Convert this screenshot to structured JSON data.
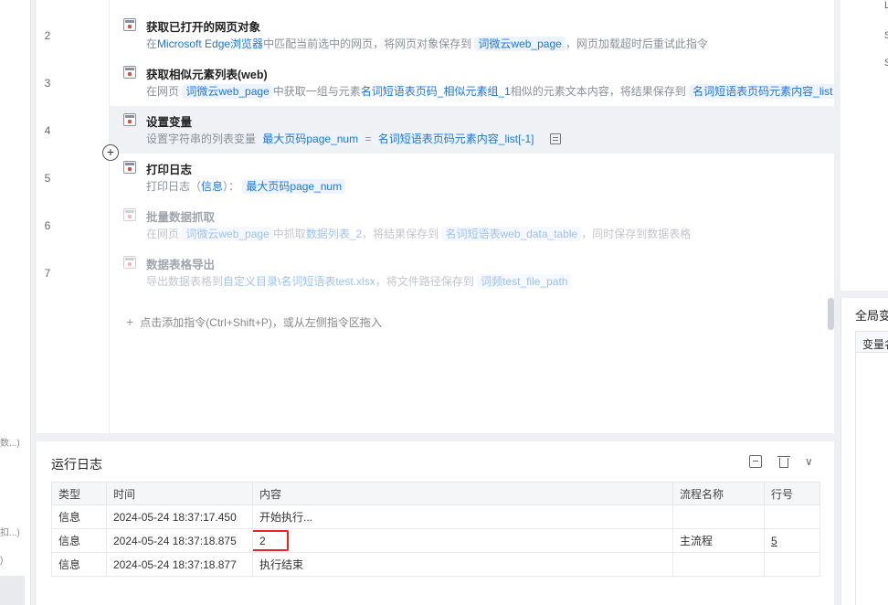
{
  "left_panel": {
    "fragments": [
      "数...)",
      "扣...)",
      ")"
    ]
  },
  "editor": {
    "line_numbers": [
      "2",
      "3",
      "4",
      "5",
      "6",
      "7"
    ],
    "steps": [
      {
        "title": "获取已打开的网页对象",
        "desc": {
          "t1": "在",
          "b1": "Microsoft Edge浏览器",
          "t2": "中匹配当前选中的网页，将网页对象保存到",
          "c1": "词微云web_page",
          "t3": "，网页加载超时后重试此指令"
        }
      },
      {
        "title": "获取相似元素列表(web)",
        "desc": {
          "t1": "在网页",
          "c1": "词微云web_page",
          "t2": "中获取一组与元素",
          "b1": "名词短语表页码_相似元素组_1",
          "t3": "相似的元素文本内容，将结果保存到",
          "c2": "名词短语表页码元素内容_list"
        }
      },
      {
        "title": "设置变量",
        "desc": {
          "t1": "设置字符串的列表变量",
          "c1": "最大页码page_num",
          "t2": "=",
          "c2": "名词短语表页码元素内容_list[-1]"
        }
      },
      {
        "title": "打印日志",
        "desc": {
          "t1": "打印日志（",
          "b1": "信息",
          "t2": "）：",
          "c1": "最大页码page_num"
        }
      },
      {
        "title": "批量数据抓取",
        "desc": {
          "t1": "在网页",
          "c1": "词微云web_page",
          "t2": "中抓取",
          "b1": "数据列表_2",
          "t3": "，将结果保存到",
          "c2": "名词短语表web_data_table",
          "t4": "，同时保存到数据表格"
        }
      },
      {
        "title": "数据表格导出",
        "desc": {
          "t1": "导出数据表格到",
          "b1": "自定义目录\\名词短语表test.xlsx",
          "t2": "，将文件路径保存到",
          "c1": "词频test_file_path"
        }
      }
    ],
    "add_hint": "点击添加指令(Ctrl+Shift+P)，或从左侧指令区拖入"
  },
  "right_panel": {
    "title": "全局变",
    "col_header": "变量名",
    "glyphs": [
      "L",
      "S",
      "S"
    ]
  },
  "log": {
    "title": "运行日志",
    "columns": [
      "类型",
      "时间",
      "内容",
      "流程名称",
      "行号"
    ],
    "rows": [
      {
        "type": "信息",
        "time": "2024-05-24 18:37:17.450",
        "content": "开始执行...",
        "flow": "",
        "line": ""
      },
      {
        "type": "信息",
        "time": "2024-05-24 18:37:18.875",
        "content": "2",
        "flow": "主流程",
        "line": "5"
      },
      {
        "type": "信息",
        "time": "2024-05-24 18:37:18.877",
        "content": "执行结束",
        "flow": "",
        "line": ""
      }
    ]
  },
  "colors": {
    "accent": "#1b74e8",
    "highlight": "#ee2222"
  }
}
